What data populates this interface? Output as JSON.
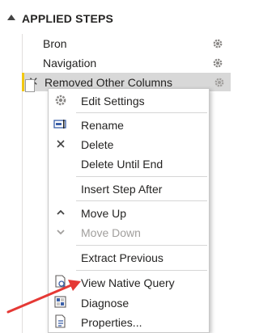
{
  "pane": {
    "title": "APPLIED STEPS"
  },
  "steps": [
    {
      "label": "Bron"
    },
    {
      "label": "Navigation"
    },
    {
      "label": "Removed Other Columns"
    }
  ],
  "context_menu": {
    "items": [
      {
        "label": "Edit Settings",
        "icon": "gear-icon",
        "enabled": true
      },
      {
        "label": "Rename",
        "icon": "rename-icon",
        "enabled": true
      },
      {
        "label": "Delete",
        "icon": "delete-x-icon",
        "enabled": true
      },
      {
        "label": "Delete Until End",
        "icon": "",
        "enabled": true
      },
      {
        "label": "Insert Step After",
        "icon": "",
        "enabled": true
      },
      {
        "label": "Move Up",
        "icon": "chevron-up-icon",
        "enabled": true
      },
      {
        "label": "Move Down",
        "icon": "chevron-down-icon",
        "enabled": false
      },
      {
        "label": "Extract Previous",
        "icon": "",
        "enabled": true
      },
      {
        "label": "View Native Query",
        "icon": "native-query-icon",
        "enabled": true
      },
      {
        "label": "Diagnose",
        "icon": "diagnose-icon",
        "enabled": true
      },
      {
        "label": "Properties...",
        "icon": "properties-icon",
        "enabled": true
      }
    ]
  },
  "colors": {
    "selection_accent": "#f2c811",
    "selection_bg": "#d8d8d8",
    "annotation_arrow": "#e53935"
  }
}
